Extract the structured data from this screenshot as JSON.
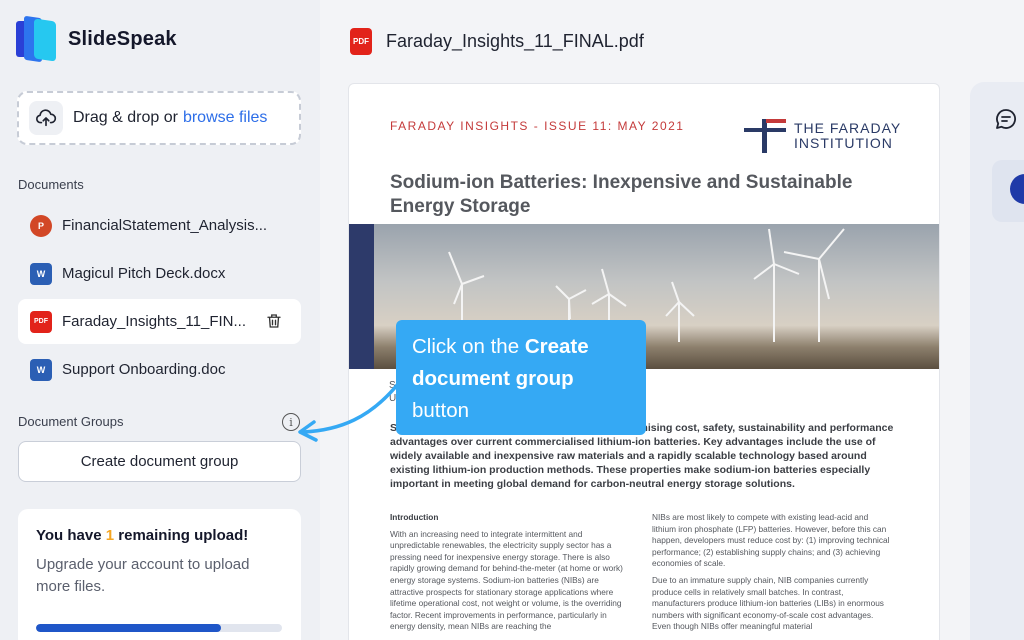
{
  "app": {
    "name": "SlideSpeak"
  },
  "upload": {
    "text": "Drag & drop or",
    "link": "browse files"
  },
  "documents": {
    "title": "Documents",
    "items": [
      {
        "label": "FinancialStatement_Analysis...",
        "type": "P"
      },
      {
        "label": "Magicul Pitch Deck.docx",
        "type": "W"
      },
      {
        "label": "Faraday_Insights_11_FIN...",
        "type": "PDF"
      },
      {
        "label": "Support Onboarding.doc",
        "type": "W"
      }
    ]
  },
  "groups": {
    "title": "Document Groups",
    "info": "i",
    "create_label": "Create document group"
  },
  "upgrade": {
    "prefix": "You have ",
    "count": "1",
    "suffix": " remaining upload!",
    "desc": "Upgrade your account to upload more files.",
    "progress": 0.75
  },
  "file": {
    "title": "Faraday_Insights_11_FINAL.pdf",
    "icon": "PDF"
  },
  "document": {
    "issue": "FARADAY INSIGHTS - ISSUE 11: MAY 2021",
    "logo_line1": "THE FARADAY",
    "logo_line2": "INSTITUTION",
    "title": "Sodium-ion Batteries: Inexpensive and Sustainable Energy Storage",
    "snip1": "S",
    "snip2": "U",
    "abstract": "S                                                        nology with promising cost, safety, sustainability and performance advantages over current commercialised lithium-ion batteries. Key advantages include the use of widely available and inexpensive raw materials and a rapidly scalable technology based around existing lithium-ion production methods. These properties make sodium-ion batteries especially important in meeting global demand for carbon-neutral energy storage solutions.",
    "intro_heading": "Introduction",
    "col1": "With an increasing need to integrate intermittent and unpredictable renewables, the electricity supply sector has a pressing need for inexpensive energy storage. There is also rapidly growing demand for behind-the-meter (at home or work) energy storage systems. Sodium-ion batteries (NIBs) are attractive prospects for stationary storage applications where lifetime operational cost, not weight or volume, is the overriding factor. Recent improvements in performance, particularly in energy density, mean NIBs are reaching the",
    "col2a": "NIBs are most likely to compete with existing lead-acid and lithium iron phosphate (LFP) batteries. However, before this can happen, developers must reduce cost by: (1) improving technical performance; (2) establishing supply chains; and (3) achieving economies of scale.",
    "col2b": "Due to an immature supply chain, NIB companies currently produce cells in relatively small batches. In contrast, manufacturers produce lithium-ion batteries (LIBs) in enormous numbers with significant economy-of-scale cost advantages. Even though NIBs offer meaningful material"
  },
  "tooltip": {
    "pre": "Click on the ",
    "bold": "Create document group",
    "post": " button"
  },
  "colors": {
    "accent": "#35a9f4",
    "link": "#2d6ee8",
    "highlight": "#f5a623",
    "progress": "#1f56c8"
  }
}
